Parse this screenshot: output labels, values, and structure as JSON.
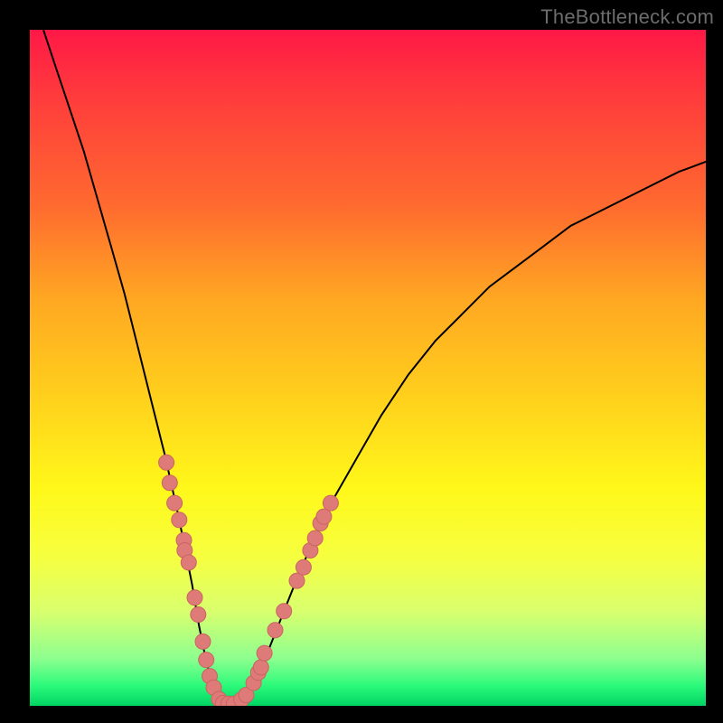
{
  "watermark": "TheBottleneck.com",
  "chart_data": {
    "type": "line",
    "title": "",
    "xlabel": "",
    "ylabel": "",
    "xlim": [
      0,
      100
    ],
    "ylim": [
      0,
      100
    ],
    "series": [
      {
        "name": "curve",
        "x": [
          2,
          4,
          6,
          8,
          10,
          12,
          14,
          16,
          18,
          20,
          22,
          24,
          25,
          26,
          27,
          28,
          29,
          30,
          31,
          32,
          34,
          36,
          38,
          40,
          44,
          48,
          52,
          56,
          60,
          64,
          68,
          72,
          76,
          80,
          84,
          88,
          92,
          96,
          100
        ],
        "values": [
          100,
          94,
          88,
          82,
          75,
          68,
          61,
          53,
          45,
          37,
          28,
          18,
          12,
          7,
          3.2,
          1.2,
          0.3,
          0.2,
          0.6,
          1.6,
          5.0,
          10,
          15,
          20,
          29,
          36,
          43,
          49,
          54,
          58,
          62,
          65,
          68,
          71,
          73,
          75,
          77,
          79,
          80.5
        ]
      }
    ],
    "scatter": [
      {
        "x": 20.2,
        "y": 36
      },
      {
        "x": 20.7,
        "y": 33
      },
      {
        "x": 21.4,
        "y": 30
      },
      {
        "x": 22.1,
        "y": 27.5
      },
      {
        "x": 22.8,
        "y": 24.5
      },
      {
        "x": 22.9,
        "y": 23
      },
      {
        "x": 23.5,
        "y": 21.2
      },
      {
        "x": 24.4,
        "y": 16
      },
      {
        "x": 24.9,
        "y": 13.5
      },
      {
        "x": 25.6,
        "y": 9.5
      },
      {
        "x": 26.1,
        "y": 6.8
      },
      {
        "x": 26.6,
        "y": 4.4
      },
      {
        "x": 27.2,
        "y": 2.7
      },
      {
        "x": 28.0,
        "y": 1.0
      },
      {
        "x": 28.6,
        "y": 0.4
      },
      {
        "x": 29.4,
        "y": 0.3
      },
      {
        "x": 30.2,
        "y": 0.3
      },
      {
        "x": 31.3,
        "y": 0.9
      },
      {
        "x": 32.0,
        "y": 1.6
      },
      {
        "x": 33.1,
        "y": 3.4
      },
      {
        "x": 33.8,
        "y": 4.9
      },
      {
        "x": 34.2,
        "y": 5.7
      },
      {
        "x": 34.7,
        "y": 7.8
      },
      {
        "x": 36.3,
        "y": 11.2
      },
      {
        "x": 37.6,
        "y": 14
      },
      {
        "x": 39.5,
        "y": 18.5
      },
      {
        "x": 40.5,
        "y": 20.5
      },
      {
        "x": 41.5,
        "y": 23
      },
      {
        "x": 42.2,
        "y": 24.8
      },
      {
        "x": 43.0,
        "y": 27
      },
      {
        "x": 43.5,
        "y": 28
      },
      {
        "x": 44.5,
        "y": 30
      }
    ]
  }
}
